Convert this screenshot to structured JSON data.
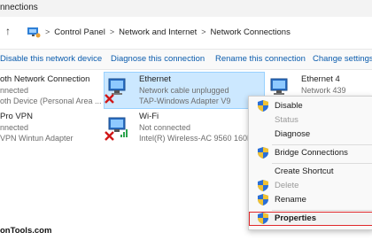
{
  "window": {
    "title_fragment": "nnections"
  },
  "address": {
    "crumbs": [
      "Control Panel",
      "Network and Internet",
      "Network Connections"
    ],
    "separator": ">"
  },
  "commands": {
    "disable": "Disable this network device",
    "diagnose": "Diagnose this connection",
    "rename": "Rename this connection",
    "change": "Change settings o"
  },
  "items": {
    "bluetooth": {
      "name": "oth Network Connection",
      "line1": "nnected",
      "line2": "oth Device (Personal Area ..."
    },
    "ethernet": {
      "name": "Ethernet",
      "line1": "Network cable unplugged",
      "line2": "TAP-Windows Adapter V9"
    },
    "ethernet4": {
      "name": "Ethernet 4",
      "line1": "Network 439"
    },
    "provpn": {
      "name": "Pro VPN",
      "line1": "nnected",
      "line2": "VPN Wintun Adapter"
    },
    "wifi": {
      "name": "Wi-Fi",
      "line1": "Not connected",
      "line2": "Intel(R) Wireless-AC 9560 160MH..."
    }
  },
  "context_menu": {
    "disable": "Disable",
    "status": "Status",
    "diagnose": "Diagnose",
    "bridge": "Bridge Connections",
    "shortcut": "Create Shortcut",
    "delete": "Delete",
    "rename": "Rename",
    "properties": "Properties"
  },
  "watermark": "onTools.com",
  "colors": {
    "selection": "#cce8ff",
    "link": "#0b5cad",
    "highlight_border": "#e0282b"
  }
}
